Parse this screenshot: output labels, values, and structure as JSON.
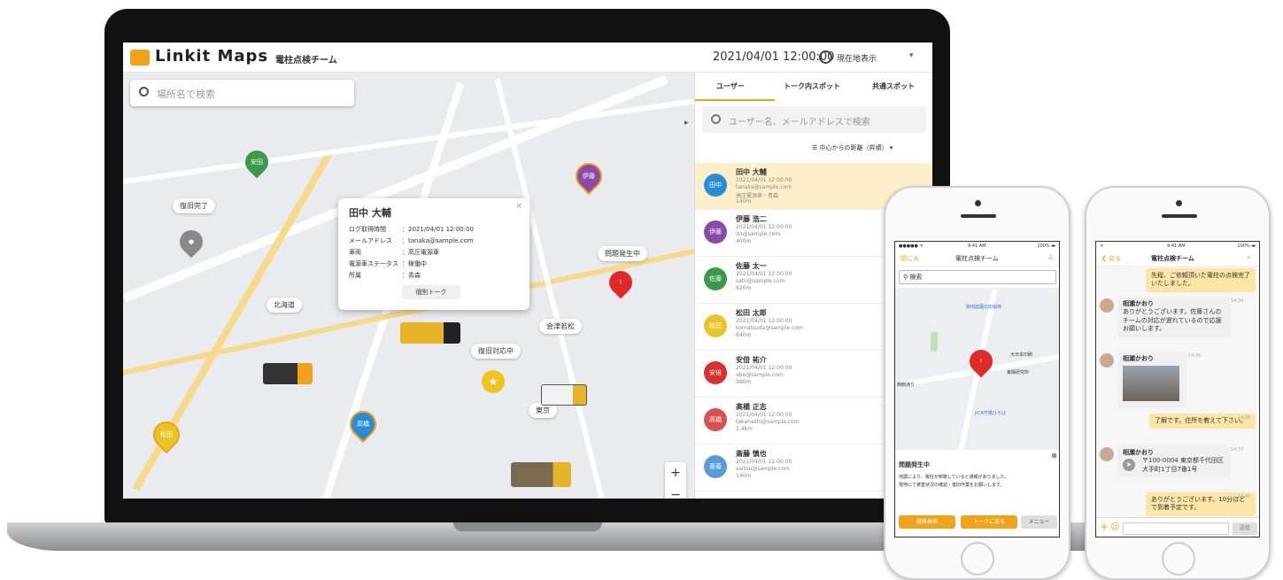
{
  "app": {
    "logo": "Linkit Maps",
    "team_name": "電柱点検チーム",
    "datetime": "2021/04/01 12:00:00",
    "location_button": "現在地表示",
    "map_search_placeholder": "場所名で検索",
    "accent": "#f0a21a"
  },
  "map": {
    "labels": {
      "fukkyu_kanryo": "復旧完了",
      "hokkaido": "北海道",
      "aizu": "会津若松",
      "fukkyu_taio": "復旧対応中",
      "tokyo": "東京",
      "mondai": "問題発生中"
    },
    "pins": {
      "yasuda": "安田",
      "ito": "伊藤",
      "takahashi": "高橋",
      "matsuda": "松田"
    },
    "zoom_in": "+",
    "zoom_out": "−"
  },
  "popup": {
    "name": "田中 大輔",
    "rows": [
      {
        "k": "ログ取得時間",
        "v": "：2021/04/01 12:00:00"
      },
      {
        "k": "メールアドレス",
        "v": "：tanaka@sample.com"
      },
      {
        "k": "車両",
        "v": "：高圧電源車"
      },
      {
        "k": "電源車ステータス",
        "v": "：稼働中"
      },
      {
        "k": "所属",
        "v": "：青森"
      }
    ],
    "talk_button": "個別トーク",
    "close": "×"
  },
  "panel": {
    "tabs": [
      "ユーザー",
      "トーク内スポット",
      "共通スポット"
    ],
    "search_placeholder": "ユーザー名、メールアドレスで検索",
    "sort_label": "中心からの距離（昇順）",
    "users": [
      {
        "avatar": "田中",
        "name": "田中 大輔",
        "time": "2021/04/01 12:00:00",
        "email": "tanaka@sample.com",
        "extra": "高圧電源車・青森",
        "dist": "140m",
        "color": "#2a8bd6"
      },
      {
        "avatar": "伊藤",
        "name": "伊藤 浩二",
        "time": "2021/04/01 12:00:00",
        "email": "ito@sample.com",
        "extra": "",
        "dist": "400m",
        "color": "#8a4aa8"
      },
      {
        "avatar": "佐藤",
        "name": "佐藤 太一",
        "time": "2021/04/01 12:00:00",
        "email": "sato@sample.com",
        "extra": "",
        "dist": "620m",
        "color": "#3a9a4a"
      },
      {
        "avatar": "松田",
        "name": "松田 太郎",
        "time": "2021/04/01 12:00:00",
        "email": "komatsuda@sample.com",
        "extra": "",
        "dist": "640m",
        "color": "#e8c428"
      },
      {
        "avatar": "安倍",
        "name": "安倍 祐介",
        "time": "2021/04/01 12:00:00",
        "email": "abe@sample.com",
        "extra": "",
        "dist": "980m",
        "color": "#d93030"
      },
      {
        "avatar": "高橋",
        "name": "高橋 正志",
        "time": "2021/04/01 12:00:00",
        "email": "takahashi@sample.com",
        "extra": "",
        "dist": "1.4km",
        "color": "#d85050"
      },
      {
        "avatar": "斎藤",
        "name": "斎藤 慎也",
        "time": "2021/04/01 12:00:00",
        "email": "saitou@sample.com",
        "extra": "",
        "dist": "140m",
        "color": "#5a9ad6"
      }
    ]
  },
  "phone1": {
    "carrier": "●●●●● ᯤ",
    "time": "9:41 AM",
    "battery": "100% ▬",
    "close": "閉じる",
    "title": "電柱点検チーム",
    "search": "検索",
    "map_labels": [
      "駒田庭園北田稲荷",
      "大日本印刷",
      "東陽研究所",
      "JICA竹橋ひろば",
      "鶴鶴通り"
    ],
    "sheet_title": "問題発生中",
    "sheet_text_1": "地震により、電柱が倒壊していると通報がありました。",
    "sheet_text_2": "現地にて被害状況の確認・復旧作業をお願いします。",
    "btn_route": "経路検索",
    "btn_talk": "トークに送る",
    "btn_menu": "メニュー"
  },
  "phone2": {
    "carrier": "ᯤ",
    "time": "9:41 AM",
    "battery": "100% ▬",
    "back": "戻る",
    "title": "電柱点検チーム",
    "msg_top": "先程、ご依頼頂いた電柱の点検完了いたしました。",
    "sender": "相瀬かおり",
    "t1": "14:34",
    "msg1": "ありがとうございます。佐藤さんのチームの対応が遅れているので応援お願いします。",
    "t2": "14:35",
    "t3": "14:36",
    "msg_me": "了解です。住所を教えて下さい。",
    "t4": "14:37",
    "msg_addr": "〒100-0004 東京都千代田区 大手町1丁目7番1号",
    "t5": "14:40",
    "msg_last": "ありがとうございます。10分ほどで到着予定です。",
    "send": "送信"
  }
}
